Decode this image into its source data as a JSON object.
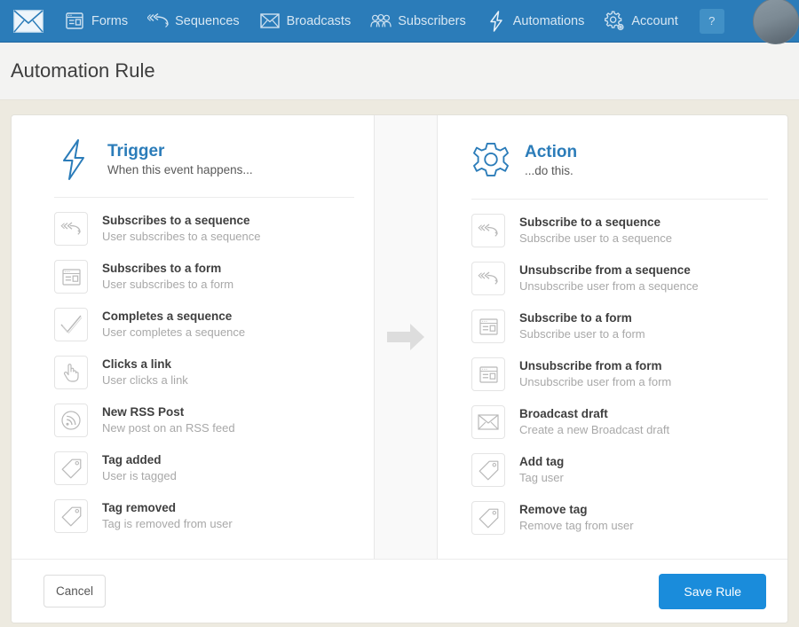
{
  "nav": {
    "logo_icon": "envelope-logo-icon",
    "items": [
      {
        "label": "Forms",
        "icon": "form-window-icon"
      },
      {
        "label": "Sequences",
        "icon": "double-chevron-arrow-icon"
      },
      {
        "label": "Broadcasts",
        "icon": "envelope-icon"
      },
      {
        "label": "Subscribers",
        "icon": "people-group-icon"
      },
      {
        "label": "Automations",
        "icon": "lightning-bolt-icon"
      },
      {
        "label": "Account",
        "icon": "gear-icon"
      }
    ],
    "help_label": "?",
    "avatar_icon": "user-avatar"
  },
  "page": {
    "title": "Automation Rule"
  },
  "trigger": {
    "icon": "lightning-bolt-icon",
    "title": "Trigger",
    "subtitle": "When this event happens...",
    "options": [
      {
        "title": "Subscribes to a sequence",
        "desc": "User subscribes to a sequence",
        "icon": "double-chevron-arrow-icon"
      },
      {
        "title": "Subscribes to a form",
        "desc": "User subscribes to a form",
        "icon": "form-window-icon"
      },
      {
        "title": "Completes a sequence",
        "desc": "User completes a sequence",
        "icon": "checkmark-icon"
      },
      {
        "title": "Clicks a link",
        "desc": "User clicks a link",
        "icon": "pointer-hand-icon"
      },
      {
        "title": "New RSS Post",
        "desc": "New post on an RSS feed",
        "icon": "rss-icon"
      },
      {
        "title": "Tag added",
        "desc": "User is tagged",
        "icon": "tag-icon"
      },
      {
        "title": "Tag removed",
        "desc": "Tag is removed from user",
        "icon": "tag-icon"
      }
    ]
  },
  "separator": {
    "icon": "arrow-right-icon"
  },
  "action": {
    "icon": "gear-icon",
    "title": "Action",
    "subtitle": "...do this.",
    "options": [
      {
        "title": "Subscribe to a sequence",
        "desc": "Subscribe user to a sequence",
        "icon": "double-chevron-arrow-icon"
      },
      {
        "title": "Unsubscribe from a sequence",
        "desc": "Unsubscribe user from a sequence",
        "icon": "double-chevron-arrow-icon"
      },
      {
        "title": "Subscribe to a form",
        "desc": "Subscribe user to a form",
        "icon": "form-window-icon"
      },
      {
        "title": "Unsubscribe from a form",
        "desc": "Unsubscribe user from a form",
        "icon": "form-window-icon"
      },
      {
        "title": "Broadcast draft",
        "desc": "Create a new Broadcast draft",
        "icon": "envelope-icon"
      },
      {
        "title": "Add tag",
        "desc": "Tag user",
        "icon": "tag-icon"
      },
      {
        "title": "Remove tag",
        "desc": "Remove tag from user",
        "icon": "tag-icon"
      }
    ]
  },
  "footer": {
    "cancel_label": "Cancel",
    "save_label": "Save Rule"
  },
  "colors": {
    "nav_blue": "#2b7cb9",
    "accent_blue": "#2b7cb9",
    "save_blue": "#1a8cdb",
    "page_bg": "#edeae0",
    "title_band": "#f3f3f2"
  }
}
